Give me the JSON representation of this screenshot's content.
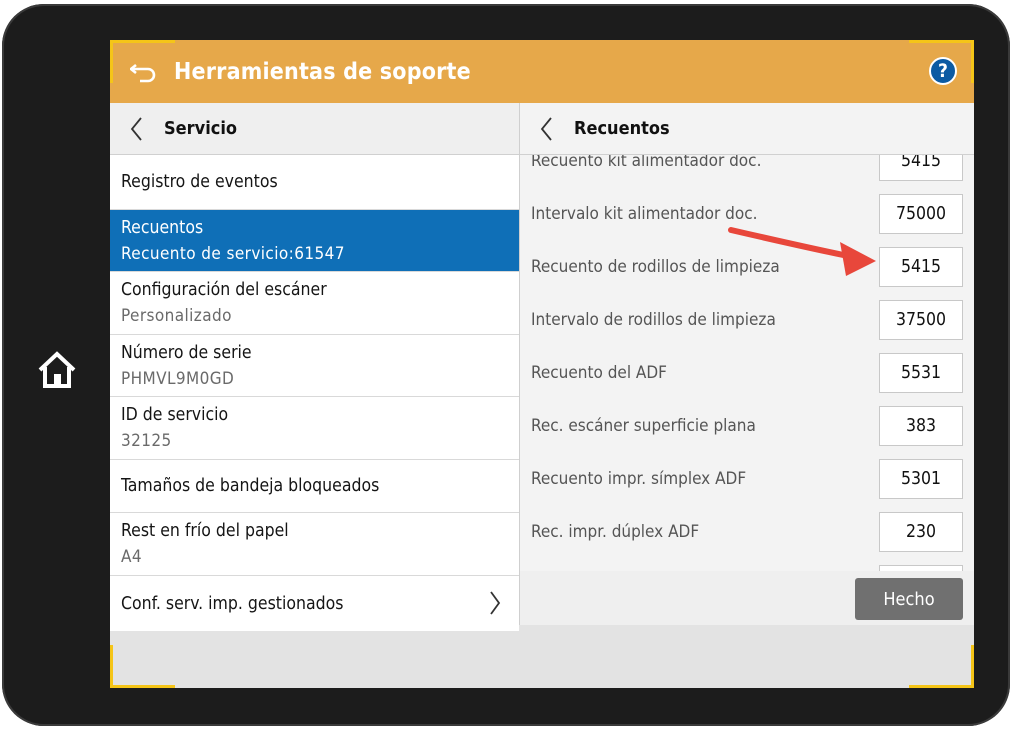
{
  "header": {
    "title": "Herramientas de soporte",
    "help_label": "?"
  },
  "left_panel": {
    "title": "Servicio",
    "items": [
      {
        "label": "Registro de eventos",
        "sub": ""
      },
      {
        "label": "Recuentos",
        "sub": "Recuento de servicio:61547",
        "selected": true
      },
      {
        "label": "Configuración del escáner",
        "sub": "Personalizado"
      },
      {
        "label": "Número de serie",
        "sub": "PHMVL9M0GD"
      },
      {
        "label": "ID de servicio",
        "sub": "32125"
      },
      {
        "label": "Tamaños de bandeja bloqueados",
        "sub": ""
      },
      {
        "label": "Rest en frío del papel",
        "sub": "A4"
      },
      {
        "label": "Conf. serv. imp. gestionados",
        "sub": "",
        "has_chevron": true
      }
    ]
  },
  "right_panel": {
    "title": "Recuentos",
    "rows": [
      {
        "label": "Recuento kit alimentador doc.",
        "value": "5415"
      },
      {
        "label": "Intervalo kit alimentador doc.",
        "value": "75000"
      },
      {
        "label": "Recuento de rodillos de limpieza",
        "value": "5415"
      },
      {
        "label": "Intervalo de rodillos de limpieza",
        "value": "37500"
      },
      {
        "label": "Recuento del ADF",
        "value": "5531"
      },
      {
        "label": "Rec. escáner superficie plana",
        "value": "383"
      },
      {
        "label": "Recuento impr. símplex ADF",
        "value": "5301"
      },
      {
        "label": "Rec. impr. dúplex ADF",
        "value": "230"
      }
    ],
    "done_label": "Hecho"
  },
  "colors": {
    "header_bg": "#e6a84a",
    "selected_bg": "#0f6fb7",
    "corner_accent": "#f5c518",
    "annotation_arrow": "#e8473b",
    "done_button": "#707070"
  },
  "icons": {
    "home": "home-icon",
    "back": "back-arrow-icon",
    "help": "help-icon",
    "chevron_left": "chevron-left-icon",
    "chevron_right": "chevron-right-icon"
  }
}
